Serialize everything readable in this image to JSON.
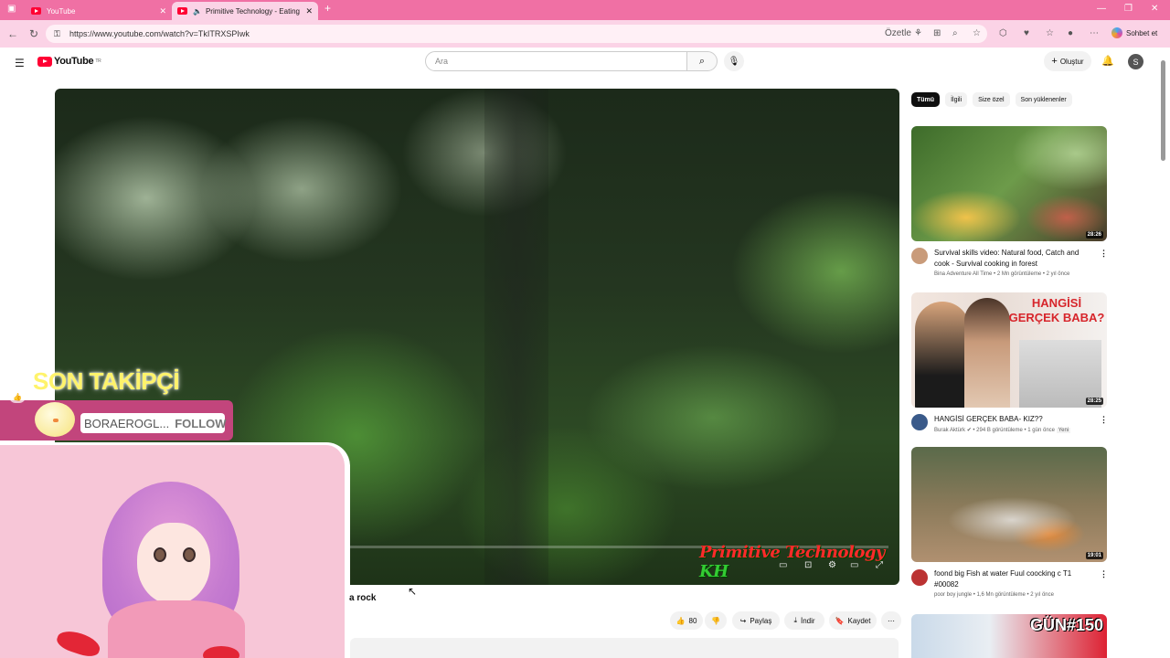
{
  "browser": {
    "tabs": [
      {
        "title": "YouTube",
        "active": false
      },
      {
        "title": "Primitive Technology - Eating",
        "active": true
      }
    ],
    "url": "https://www.youtube.com/watch?v=TkITRXSPIwk",
    "summarize_label": "Özetle",
    "copilot_label": "Sohbet et"
  },
  "youtube": {
    "logo_text": "YouTube",
    "logo_sup": "TR",
    "search_placeholder": "Ara",
    "create_label": "Oluştur",
    "avatar_letter": "S"
  },
  "player": {
    "watermark": "Primitive Technology",
    "watermark_suffix": "KH"
  },
  "overlay": {
    "heading": "SON TAKİPÇİ",
    "follower_name": "BORAEROGL...",
    "follow_label": "FOLLOW"
  },
  "video": {
    "title_fragment": "a rock",
    "like_count": "80",
    "share_label": "Paylaş",
    "download_label": "İndir",
    "save_label": "Kaydet"
  },
  "chips": [
    "Tümü",
    "İlgili",
    "Size özel",
    "Son yüklenenler"
  ],
  "recommendations": [
    {
      "title": "Survival skills video: Natural food, Catch and cook - Survival cooking in forest",
      "channel": "Bina Adventure All Time",
      "views": "2 Mn görüntüleme",
      "age": "2 yıl önce",
      "duration": "28:26"
    },
    {
      "title": "HANGİSİ GERÇEK BABA- KIZ??",
      "channel": "Burak Aktürk",
      "views": "294 B görüntüleme",
      "age": "1 gün önce",
      "badge": "Yeni",
      "duration": "28:25",
      "thumb_text": "HANGİSİ GERÇEK BABA?"
    },
    {
      "title": "foond big Fish at water Fuul coocking c T1 #00082",
      "channel": "poor boy jungle",
      "views": "1,6 Mn görüntüleme",
      "age": "2 yıl önce",
      "duration": "19:01"
    },
    {
      "thumb_text": "GÜN#150"
    }
  ]
}
